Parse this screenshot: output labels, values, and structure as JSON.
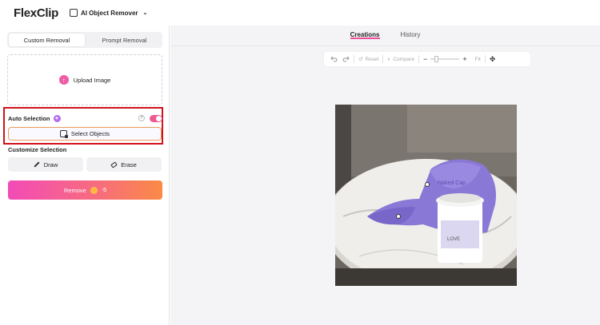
{
  "header": {
    "logo": "FlexClip",
    "tool_name": "AI Object Remover"
  },
  "left_panel": {
    "tabs": [
      {
        "label": "Custom Removal",
        "active": true
      },
      {
        "label": "Prompt Removal",
        "active": false
      }
    ],
    "upload_label": "Upload Image",
    "auto_selection": {
      "label": "Auto Selection",
      "enabled": true,
      "select_objects_label": "Select Objects"
    },
    "customize_label": "Customize Selection",
    "draw_label": "Draw",
    "erase_label": "Erase",
    "remove": {
      "label": "Remove",
      "credits": "-5"
    }
  },
  "right_panel": {
    "tabs": [
      {
        "label": "Creations",
        "active": true
      },
      {
        "label": "History",
        "active": false
      }
    ],
    "toolbar": {
      "reset_label": "Reset",
      "compare_label": "Compare",
      "fit_label": "Fit"
    }
  },
  "colors": {
    "accent_pink": "#ec4f9a",
    "highlight_red": "#d0131b",
    "remove_gradient_start": "#f24bb7",
    "remove_gradient_end": "#fb8a45"
  },
  "icons": [
    "upload-icon",
    "magic-icon",
    "help-icon",
    "select-objects-icon",
    "pencil-icon",
    "eraser-icon",
    "coin-icon",
    "undo-icon",
    "redo-icon",
    "reset-icon",
    "compare-icon",
    "zoom-out-icon",
    "zoom-in-icon",
    "move-icon",
    "chevron-down-icon"
  ]
}
